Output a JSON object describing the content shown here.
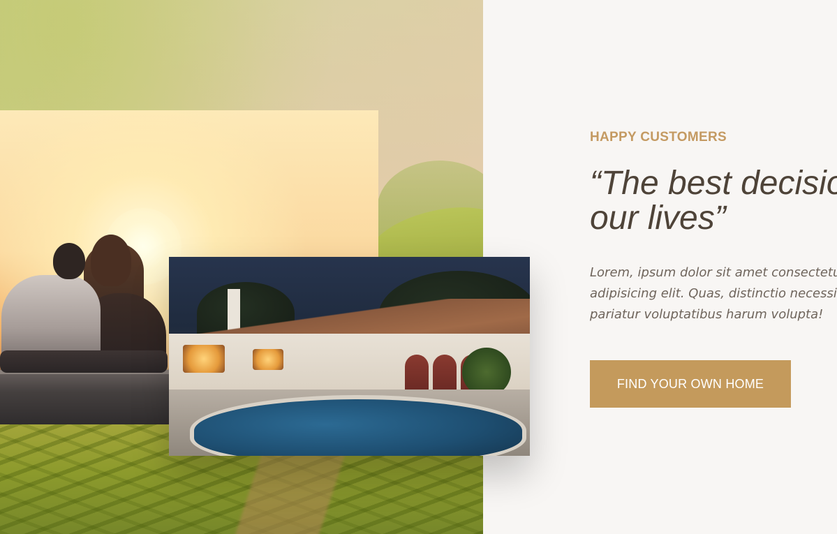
{
  "testimonial": {
    "eyebrow": "HAPPY CUSTOMERS",
    "quote": "“The best decision of our lives”",
    "body": "Lorem, ipsum dolor sit amet consectetur adipisicing elit. Quas, distinctio necessitatibus pariatur voluptatibus harum volupta!",
    "cta_label": "FIND YOUR OWN HOME"
  },
  "colors": {
    "accent": "#c49a5c",
    "heading": "#4e4338",
    "background": "#f8f6f4"
  }
}
